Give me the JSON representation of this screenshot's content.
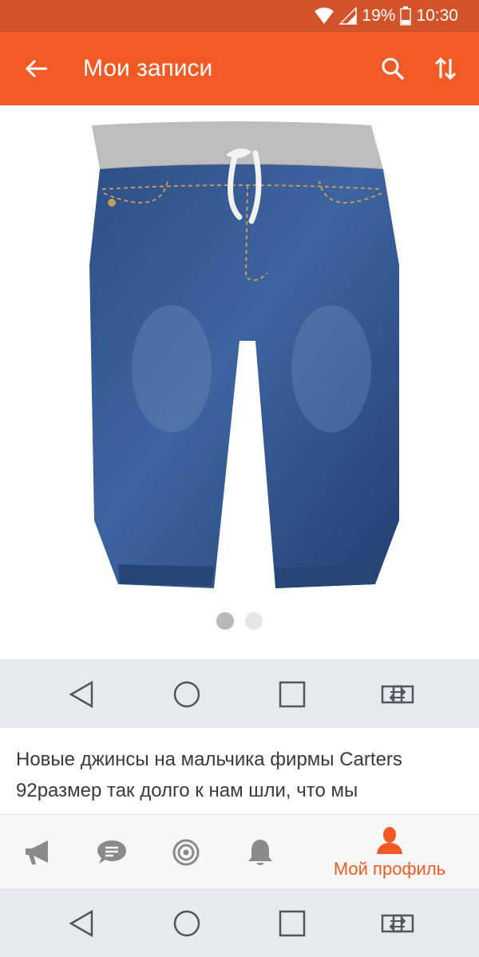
{
  "status_bar": {
    "battery": "19%",
    "time": "10:30"
  },
  "app_bar": {
    "title": "Мои записи"
  },
  "post": {
    "text_line1": "Новые джинсы на мальчика фирмы Carters",
    "text_line2": "92размер так долго к нам шли, что мы"
  },
  "bottom_nav": {
    "profile_label": "Мой профиль"
  },
  "colors": {
    "accent": "#f15a24",
    "status_bar": "#d2532a",
    "nav_bg": "#e7e9ec"
  },
  "carousel": {
    "total": 2,
    "active_index": 0
  }
}
